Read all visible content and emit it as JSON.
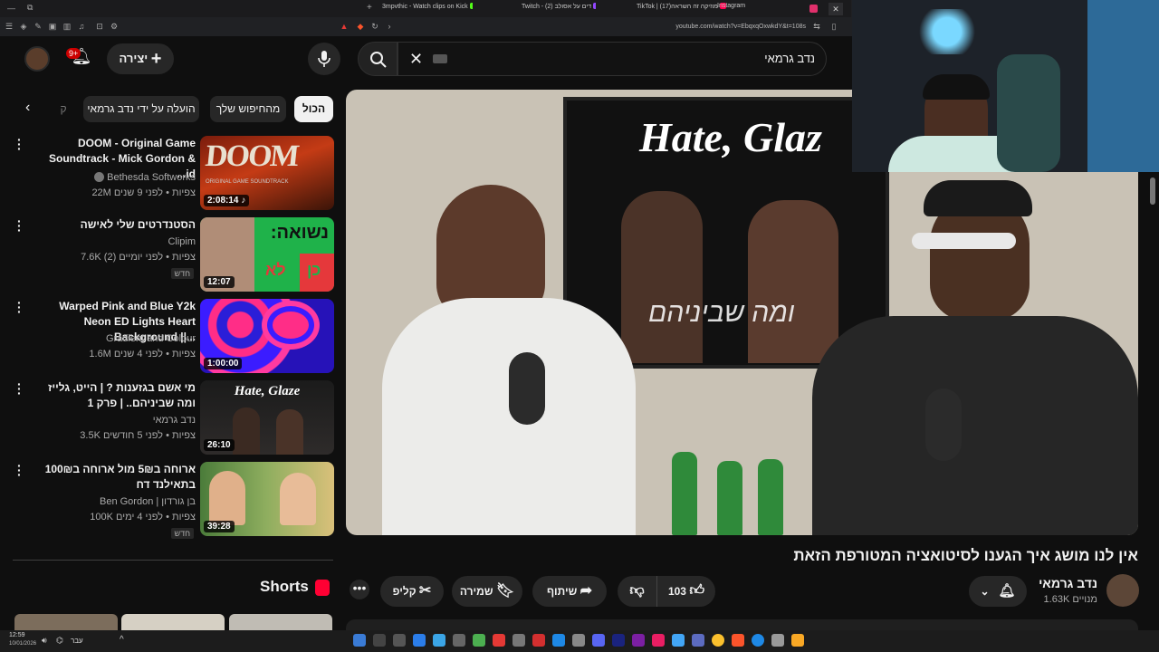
{
  "browser": {
    "tabs": [
      {
        "label": "3mpvthic - Watch clips on Kick",
        "color": "#53fc18"
      },
      {
        "label": "Twitch - (2) דים על אסולב",
        "color": "#9146ff"
      },
      {
        "label": "TikTok | (17)מוזיקה זה השראה",
        "color": "#ff0050"
      },
      {
        "label": "Instagram",
        "color": "#e1306c"
      }
    ],
    "url": "youtube.com/watch?v=EbqxqOxwkdY&t=108s"
  },
  "header": {
    "create_label": "יצירה",
    "notif_badge": "9+",
    "search_value": "נדב גרמאי"
  },
  "chips": [
    {
      "label": "הכול",
      "active": true
    },
    {
      "label": "מהחיפוש שלך",
      "active": false
    },
    {
      "label": "הועלה על ידי נדב גרמאי",
      "active": false
    },
    {
      "label": "ק",
      "active": false
    }
  ],
  "recommendations": [
    {
      "title": "DOOM - Original Game Soundtrack - Mick Gordon & id...",
      "channel": "Bethesda Softworks",
      "meta": "22M צפיות • לפני 9 שנים",
      "duration": "2:08:14",
      "badge": "",
      "verified": true
    },
    {
      "title": "הסטנדרטים שלי לאישה",
      "channel": "Clipim",
      "meta": "7.6K צפיות • לפני יומיים (2)",
      "duration": "12:07",
      "badge": "חדש",
      "verified": false
    },
    {
      "title": "Warped Pink and Blue Y2k Neon ED Lights Heart Background ||...",
      "channel": "Gradient and Colour",
      "meta": "1.6M צפיות • לפני 4 שנים",
      "duration": "1:00:00",
      "badge": "",
      "verified": false
    },
    {
      "title": "מי אשם בגזענות ? | הייט, גלייז ומה שביניהם.. | פרק 1",
      "channel": "נדב גרמאי",
      "meta": "3.5K צפיות • לפני 5 חודשים",
      "duration": "26:10",
      "badge": "",
      "verified": false
    },
    {
      "title": "ארוחה ב5₪ מול ארוחה ב100₪ בתאילנד דח",
      "channel": "Ben Gordon | בן גורדון",
      "meta": "100K צפיות • לפני 4 ימים",
      "duration": "39:28",
      "badge": "חדש",
      "verified": false
    }
  ],
  "thumb_text": {
    "doom": "DOOM",
    "doom_sub": "ORIGINAL GAME SOUNDTRACK",
    "clipim": "נשואה:",
    "clipim_no": "לא",
    "clipim_yes": "כן",
    "hate": "Hate, Glaze"
  },
  "shorts_label": "Shorts",
  "video": {
    "screen_text": "Hate, Glaz",
    "screen_sub": "ומה שביניהם"
  },
  "watch": {
    "title": "אין לנו מושג איך הגענו לסיטואציה המטורפת הזאת",
    "channel": "נדב גרמאי",
    "subs": "1.63K מנויים",
    "likes": "103",
    "share": "שיתוף",
    "save": "שמירה",
    "clip": "קליפ"
  },
  "taskbar": {
    "time": "12:59",
    "date": "10/01/2026",
    "lang": "עבר"
  },
  "colors": {
    "bg": "#0f0f0f",
    "chip_bg": "#272727",
    "youtube_red": "#ff0033"
  }
}
